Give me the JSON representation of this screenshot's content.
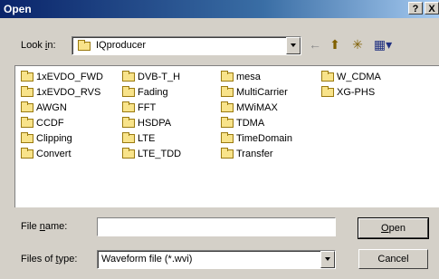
{
  "window": {
    "title": "Open",
    "help_btn": "?",
    "close_btn": "X"
  },
  "lookin": {
    "label_pre": "Look ",
    "label_key": "i",
    "label_post": "n:",
    "value": "IQproducer"
  },
  "files": [
    {
      "name": "1xEVDO_FWD"
    },
    {
      "name": "1xEVDO_RVS"
    },
    {
      "name": "AWGN"
    },
    {
      "name": "CCDF"
    },
    {
      "name": "Clipping"
    },
    {
      "name": "Convert"
    },
    {
      "name": "DVB-T_H"
    },
    {
      "name": "Fading"
    },
    {
      "name": "FFT"
    },
    {
      "name": "HSDPA"
    },
    {
      "name": "LTE"
    },
    {
      "name": "LTE_TDD"
    },
    {
      "name": "mesa"
    },
    {
      "name": "MultiCarrier"
    },
    {
      "name": "MWiMAX"
    },
    {
      "name": "TDMA"
    },
    {
      "name": "TimeDomain"
    },
    {
      "name": "Transfer"
    },
    {
      "name": "W_CDMA"
    },
    {
      "name": "XG-PHS"
    }
  ],
  "filename": {
    "label_pre": "File ",
    "label_key": "n",
    "label_post": "ame:",
    "value": ""
  },
  "filetype": {
    "label_pre": "Files of ",
    "label_key": "t",
    "label_post": "ype:",
    "value": "Waveform file (*.wvi)"
  },
  "buttons": {
    "open_key": "O",
    "open_rest": "pen",
    "cancel": "Cancel"
  },
  "toolbar": {
    "back": "←",
    "up": "⬆",
    "newfolder": "✳",
    "views": "▦▾"
  }
}
